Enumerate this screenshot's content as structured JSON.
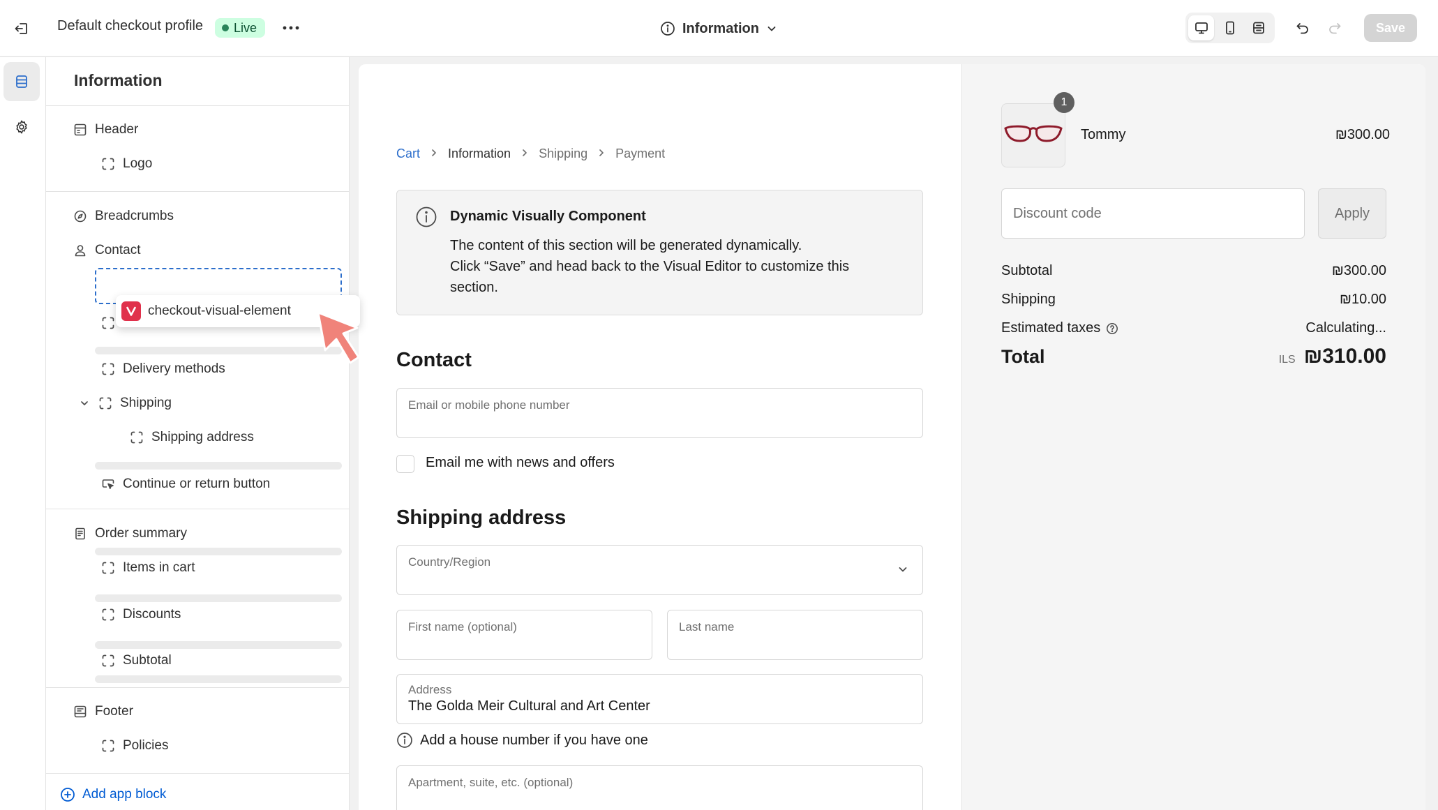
{
  "topbar": {
    "profile_name": "Default checkout profile",
    "status_badge": "Live",
    "page_selector": "Information",
    "save_label": "Save"
  },
  "sidebar": {
    "title": "Information",
    "items": {
      "header": "Header",
      "logo": "Logo",
      "breadcrumbs": "Breadcrumbs",
      "contact": "Contact",
      "delivery_methods": "Delivery methods",
      "shipping": "Shipping",
      "shipping_address": "Shipping address",
      "continue_button": "Continue or return button",
      "order_summary": "Order summary",
      "items_in_cart": "Items in cart",
      "discounts": "Discounts",
      "subtotal": "Subtotal",
      "footer": "Footer",
      "policies": "Policies"
    },
    "add_app_block": "Add app block"
  },
  "drag_chip": {
    "label": "checkout-visual-element"
  },
  "checkout": {
    "breadcrumbs": [
      "Cart",
      "Information",
      "Shipping",
      "Payment"
    ],
    "notice": {
      "title": "Dynamic Visually Component",
      "line1": "The content of this section will be generated dynamically.",
      "line2": "Click “Save” and head back to the Visual Editor to customize this section."
    },
    "contact_title": "Contact",
    "email_label": "Email or mobile phone number",
    "newsletter_label": "Email me with news and offers",
    "shipping_title": "Shipping address",
    "country_label": "Country/Region",
    "first_name_label": "First name (optional)",
    "last_name_label": "Last name",
    "address_label": "Address",
    "address_value": "The Golda Meir Cultural and Art Center",
    "house_number_hint": "Add a house number if you have one",
    "apartment_label": "Apartment, suite, etc. (optional)"
  },
  "summary": {
    "quantity": "1",
    "product_name": "Tommy",
    "product_price": "₪300.00",
    "discount_placeholder": "Discount code",
    "apply_label": "Apply",
    "subtotal_label": "Subtotal",
    "subtotal_value": "₪300.00",
    "shipping_label": "Shipping",
    "shipping_value": "₪10.00",
    "taxes_label": "Estimated taxes",
    "taxes_value": "Calculating...",
    "total_label": "Total",
    "total_currency": "ILS",
    "total_value": "₪310.00"
  },
  "colors": {
    "accent": "#2c6ecb",
    "live_bg": "#cdfee1",
    "live_dot": "#29845a",
    "cursor": "#f0837a"
  }
}
